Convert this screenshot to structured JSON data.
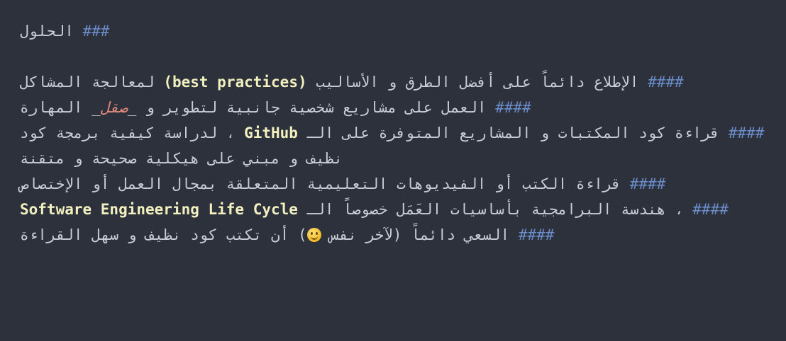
{
  "heading": {
    "marker": "###",
    "text": "الحلول"
  },
  "items": [
    {
      "marker": "####",
      "before": "الإطلاع دائماً على أفضل الطرق و الأساليب",
      "keyword": "(best practices)",
      "after": "لمعالجة المشاكل"
    },
    {
      "marker": "####",
      "before": "العمل على مشاريع شخصية جانبية لتطوير و",
      "emphasis": "صقل",
      "after": "المهارة"
    },
    {
      "marker": "####",
      "before": "قراءة كود المكتبات و المشاريع المتوفرة على الـ",
      "keyword": "GitHub",
      "after": "، لدراسة كيفية برمجة كود نظيف و مبني على هيكلية صحيحة و متقنة"
    },
    {
      "marker": "####",
      "text": "قراءة الكتب أو الفيديوهات التعليمية المتعلقة بمجال العمل أو الإختصاص"
    },
    {
      "marker": "####",
      "before": "خصوصاً الـ",
      "keyword": "Software Engineering Life Cycle",
      "after": "، هندسة البرامجية بأساسيات العَمَل"
    },
    {
      "marker": "####",
      "before": "السعي دائماً",
      "paren": "(لآخر نفس",
      "emoji": "slightly-smiling-face-icon",
      "paren_close": ")",
      "after": "أن تكتب كود نظيف و سهل القراءة"
    }
  ],
  "colors": {
    "background": "#2c313c",
    "text": "#c9cdd5",
    "marker": "#6b8cc8",
    "keyword": "#f3f0c0",
    "emphasis": "#e0897a"
  }
}
